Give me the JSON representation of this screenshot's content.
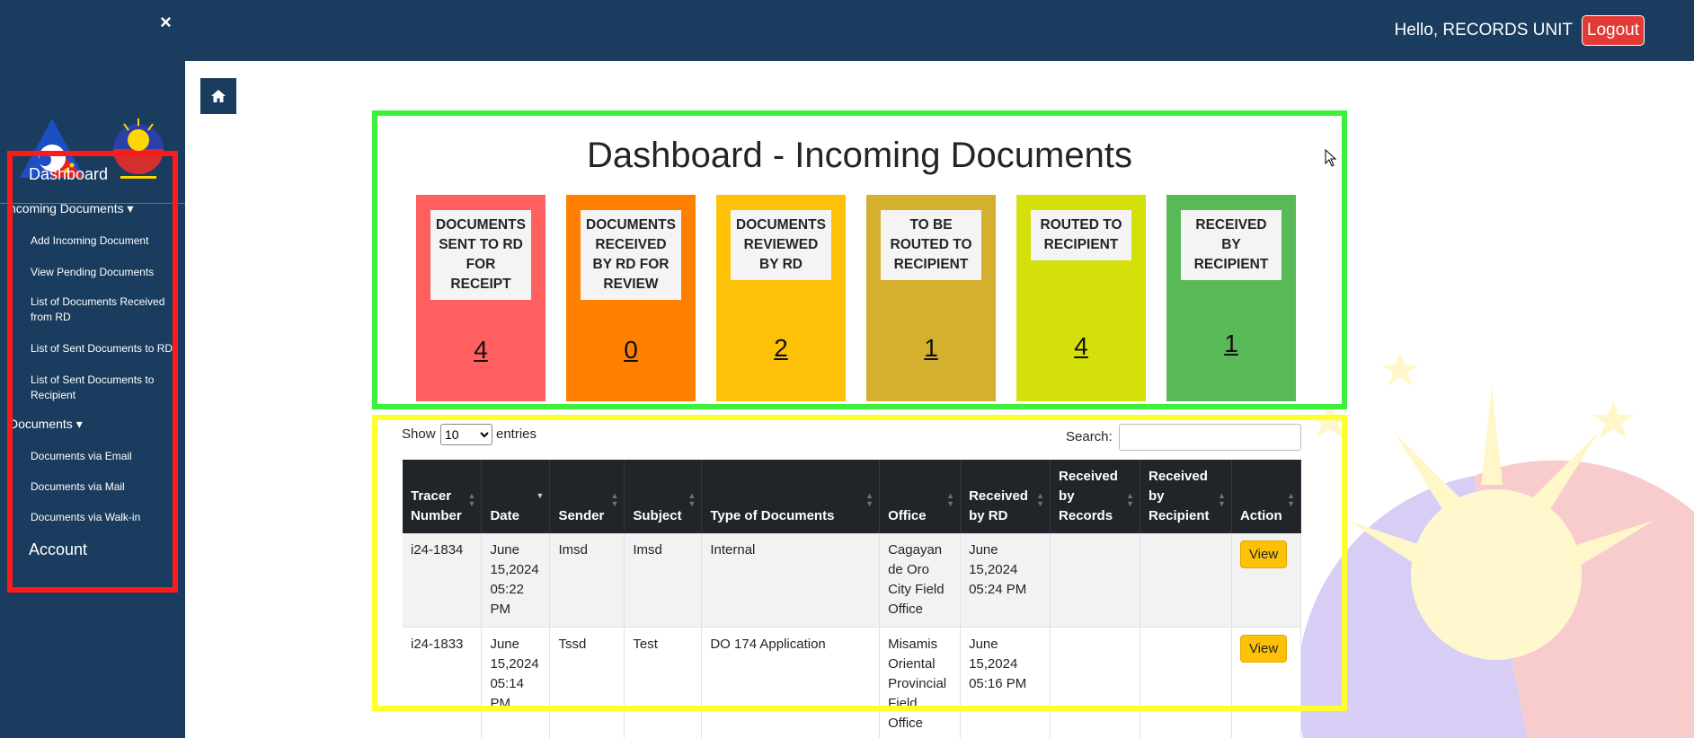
{
  "topbar": {
    "close_icon": "×",
    "greeting": "Hello, RECORDS UNIT",
    "logout_label": "Logout"
  },
  "sidebar": {
    "dashboard": "Dashboard",
    "incoming_documents": "ncoming Documents ▾",
    "incoming_items": [
      "Add Incoming Document",
      "View Pending Documents",
      "List of Documents Received from RD",
      "List of Sent Documents to RD",
      "List of Sent Documents to Recipient"
    ],
    "documents": "Documents ▾",
    "documents_items": [
      "Documents via Email",
      "Documents via Mail",
      "Documents via Walk-in"
    ],
    "account": "Account"
  },
  "dashboard": {
    "title": "Dashboard - Incoming Documents",
    "cards": [
      {
        "label": "DOCUMENTS SENT TO RD FOR RECEIPT",
        "count": "4",
        "color": "#ff5f5f"
      },
      {
        "label": "DOCUMENTS RECEIVED BY RD FOR REVIEW",
        "count": "0",
        "color": "#ff8000"
      },
      {
        "label": "DOCUMENTS REVIEWED BY RD",
        "count": "2",
        "color": "#ffc107"
      },
      {
        "label": "TO BE ROUTED TO RECIPIENT",
        "count": "1",
        "color": "#d4b02e"
      },
      {
        "label": "ROUTED TO RECIPIENT",
        "count": "4",
        "color": "#d4e00a"
      },
      {
        "label": "RECEIVED BY RECIPIENT",
        "count": "1",
        "color": "#58b957"
      }
    ]
  },
  "table": {
    "show_label": "Show",
    "entries_value": "10",
    "entries_label": "entries",
    "search_label": "Search:",
    "search_value": "",
    "headers": [
      "Tracer Number",
      "Date",
      "Sender",
      "Subject",
      "Type of Documents",
      "Office",
      "Received by RD",
      "Received by Records",
      "Received by Recipient",
      "Action"
    ],
    "rows": [
      {
        "tracer": "i24-1834",
        "date": "June 15,2024 05:22 PM",
        "sender": "Imsd",
        "subject": "Imsd",
        "type": "Internal",
        "office": "Cagayan de Oro City Field Office",
        "received_rd": "June 15,2024 05:24 PM",
        "received_records": "",
        "received_recipient": "",
        "action": "View"
      },
      {
        "tracer": "i24-1833",
        "date": "June 15,2024 05:14 PM",
        "sender": "Tssd",
        "subject": "Test",
        "type": "DO 174 Application",
        "office": "Misamis Oriental Provincial Field Office",
        "received_rd": "June 15,2024 05:16 PM",
        "received_records": "",
        "received_recipient": "",
        "action": "View"
      }
    ]
  },
  "colors": {
    "navy": "#1a3c5e",
    "highlight_red": "#ff1a1a",
    "highlight_green": "#3cf03c",
    "highlight_yellow": "#ffff2e",
    "logout": "#e53935",
    "view_button": "#ffc107"
  }
}
